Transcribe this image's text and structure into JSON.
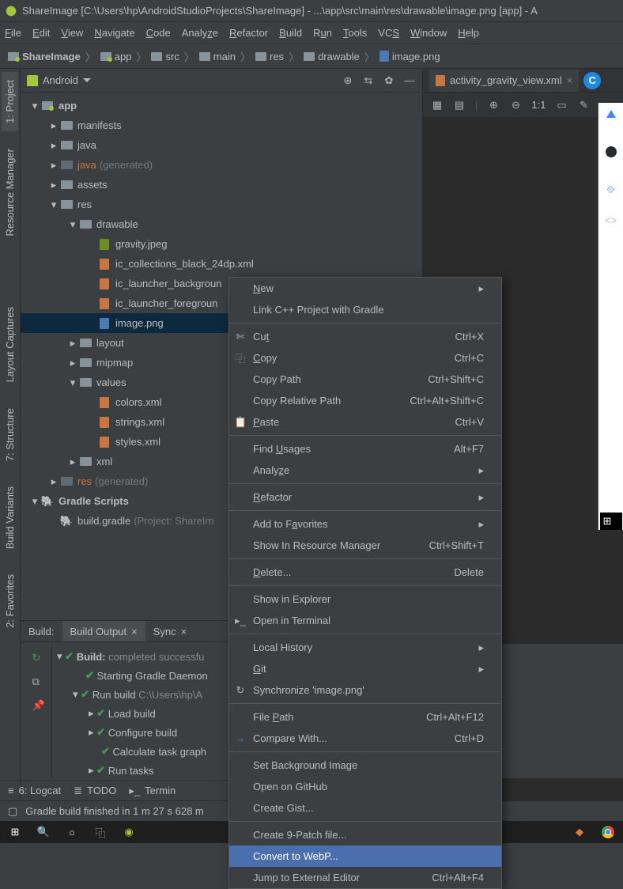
{
  "title": "ShareImage [C:\\Users\\hp\\AndroidStudioProjects\\ShareImage] - ...\\app\\src\\main\\res\\drawable\\image.png [app] - A",
  "menu": [
    "File",
    "Edit",
    "View",
    "Navigate",
    "Code",
    "Analyze",
    "Refactor",
    "Build",
    "Run",
    "Tools",
    "VCS",
    "Window",
    "Help"
  ],
  "breadcrumb": [
    "ShareImage",
    "app",
    "src",
    "main",
    "res",
    "drawable",
    "image.png"
  ],
  "project_panel": {
    "selector": "Android"
  },
  "tree": {
    "app": "app",
    "manifests": "manifests",
    "java": "java",
    "java_gen": "java",
    "gen_ann": "(generated)",
    "assets": "assets",
    "res": "res",
    "drawable": "drawable",
    "gravity": "gravity.jpeg",
    "ic_coll": "ic_collections_black_24dp.xml",
    "ic_bg": "ic_launcher_backgroun",
    "ic_fg": "ic_launcher_foregroun",
    "image": "image.png",
    "layout": "layout",
    "mipmap": "mipmap",
    "values": "values",
    "colors": "colors.xml",
    "strings": "strings.xml",
    "styles": "styles.xml",
    "xml": "xml",
    "res_gen": "res",
    "gradle_scripts": "Gradle Scripts",
    "build_gradle": "build.gradle",
    "bg_ann": "(Project: ShareIm"
  },
  "tabs": {
    "activity": "activity_gravity_view.xml"
  },
  "toolbar": {
    "ratio": "1:1"
  },
  "build_section": {
    "label": "Build:",
    "tab_output": "Build Output",
    "tab_sync": "Sync",
    "t0": "Build:",
    "t0_ann": "completed successfu",
    "t1": "Starting Gradle Daemon",
    "t2": "Run build",
    "t2_ann": "C:\\Users\\hp\\A",
    "t3": "Load build",
    "t4": "Configure build",
    "t5": "Calculate task graph",
    "t6": "Run tasks"
  },
  "status": {
    "logcat": "6: Logcat",
    "todo": "TODO",
    "terminal": "Termin"
  },
  "footer": "Gradle build finished in 1 m 27 s 628 m",
  "context": {
    "new": "New",
    "linkcpp": "Link C++ Project with Gradle",
    "cut": "Cut",
    "cut_k": "Ctrl+X",
    "copy": "Copy",
    "copy_k": "Ctrl+C",
    "copypath": "Copy Path",
    "copypath_k": "Ctrl+Shift+C",
    "copyrel": "Copy Relative Path",
    "copyrel_k": "Ctrl+Alt+Shift+C",
    "paste": "Paste",
    "paste_k": "Ctrl+V",
    "find": "Find Usages",
    "find_k": "Alt+F7",
    "analyze": "Analyze",
    "refactor": "Refactor",
    "addfav": "Add to Favorites",
    "showres": "Show In Resource Manager",
    "showres_k": "Ctrl+Shift+T",
    "delete": "Delete...",
    "delete_k": "Delete",
    "explorer": "Show in Explorer",
    "openterm": "Open in Terminal",
    "localhist": "Local History",
    "git": "Git",
    "sync": "Synchronize 'image.png'",
    "filepath": "File Path",
    "filepath_k": "Ctrl+Alt+F12",
    "compare": "Compare With...",
    "compare_k": "Ctrl+D",
    "setbg": "Set Background Image",
    "opengh": "Open on GitHub",
    "gist": "Create Gist...",
    "ninepatch": "Create 9-Patch file...",
    "webp": "Convert to WebP...",
    "jump": "Jump to External Editor",
    "jump_k": "Ctrl+Alt+F4"
  },
  "sidebar": {
    "project": "1: Project",
    "resmgr": "Resource Manager",
    "captures": "Layout Captures",
    "structure": "7: Structure",
    "buildvar": "Build Variants",
    "favorites": "2: Favorites"
  }
}
